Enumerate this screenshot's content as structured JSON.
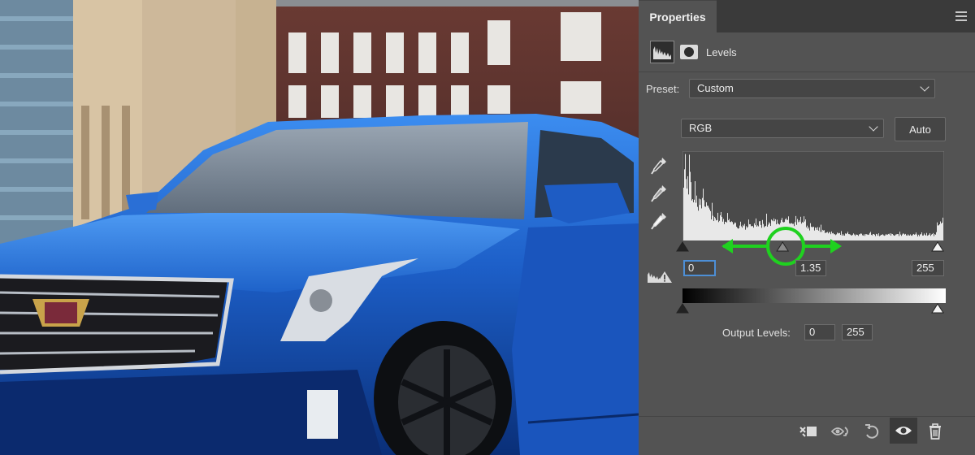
{
  "panel": {
    "tab_label": "Properties",
    "adjustment_title": "Levels",
    "preset_label": "Preset:",
    "preset_value": "Custom",
    "channel_value": "RGB",
    "auto_label": "Auto",
    "input_black": "0",
    "input_gamma": "1.35",
    "input_white": "255",
    "output_label": "Output Levels:",
    "output_black": "0",
    "output_white": "255"
  },
  "levels": {
    "input_black": 0,
    "input_gamma": 1.35,
    "input_white": 255,
    "output_black": 0,
    "output_white": 255
  },
  "colors": {
    "panel_bg": "#535353",
    "annotation_green": "#1fd11f",
    "car_blue": "#1f63c9",
    "histogram_fill": "#e8e8e8",
    "histogram_bg": "#4a4a4a"
  },
  "icons": {
    "panel_menu": "hamburger-menu-icon",
    "adjustment": "levels-histogram-icon",
    "mask": "layer-mask-icon",
    "eyedroppers": [
      "black-point-eyedropper-icon",
      "gray-point-eyedropper-icon",
      "white-point-eyedropper-icon"
    ],
    "clipping": "clipping-warning-icon",
    "footer": [
      "clip-to-layer-icon",
      "view-previous-state-icon",
      "reset-icon",
      "visibility-eye-icon",
      "trash-icon"
    ]
  }
}
